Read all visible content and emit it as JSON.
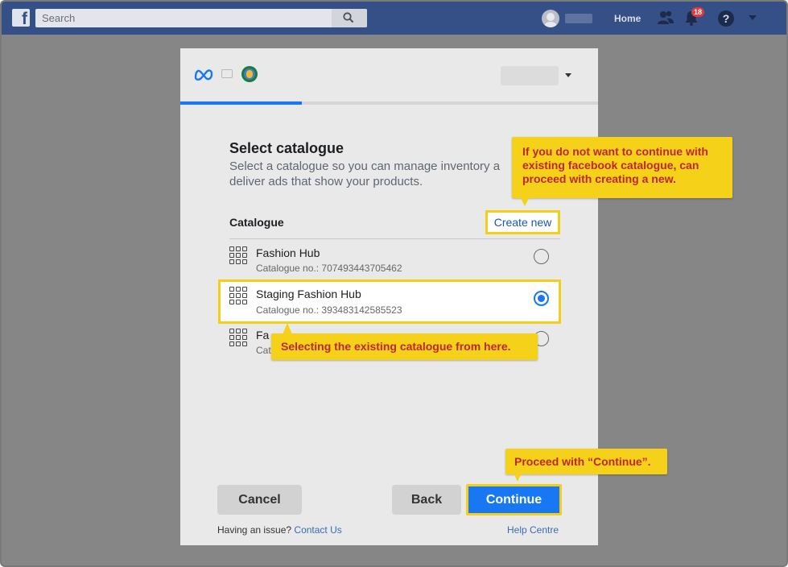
{
  "topbar": {
    "logo_letter": "f",
    "search_placeholder": "Search",
    "home_label": "Home",
    "notification_count": "18",
    "help_glyph": "?"
  },
  "dialog": {
    "title": "Select catalogue",
    "description": "Select a catalogue so you can manage inventory a deliver ads that show your products.",
    "progress_percent": 29,
    "catalogue_header": "Catalogue",
    "create_new_label": "Create new",
    "catalogues": [
      {
        "name": "Fashion Hub",
        "number": "Catalogue no.: 707493443705462",
        "selected": false
      },
      {
        "name": "Staging Fashion Hub",
        "number": "Catalogue no.: 393483142585523",
        "selected": true
      },
      {
        "name": "Fa",
        "number": "Cat",
        "selected": false
      }
    ],
    "buttons": {
      "cancel": "Cancel",
      "back": "Back",
      "continue": "Continue"
    },
    "footer": {
      "issue_text": "Having an issue?",
      "contact_link": "Contact Us",
      "help_link": "Help Centre"
    }
  },
  "callouts": {
    "create_new_note": "If you do not want to continue with existing facebook catalogue, can proceed with creating a new.",
    "select_note": "Selecting the existing catalogue from here.",
    "continue_note": "Proceed with “Continue”."
  },
  "colors": {
    "accent": "#1877f2",
    "highlight": "#f3cf1a",
    "callout_text": "#c0262d",
    "topbar": "#354f87"
  }
}
